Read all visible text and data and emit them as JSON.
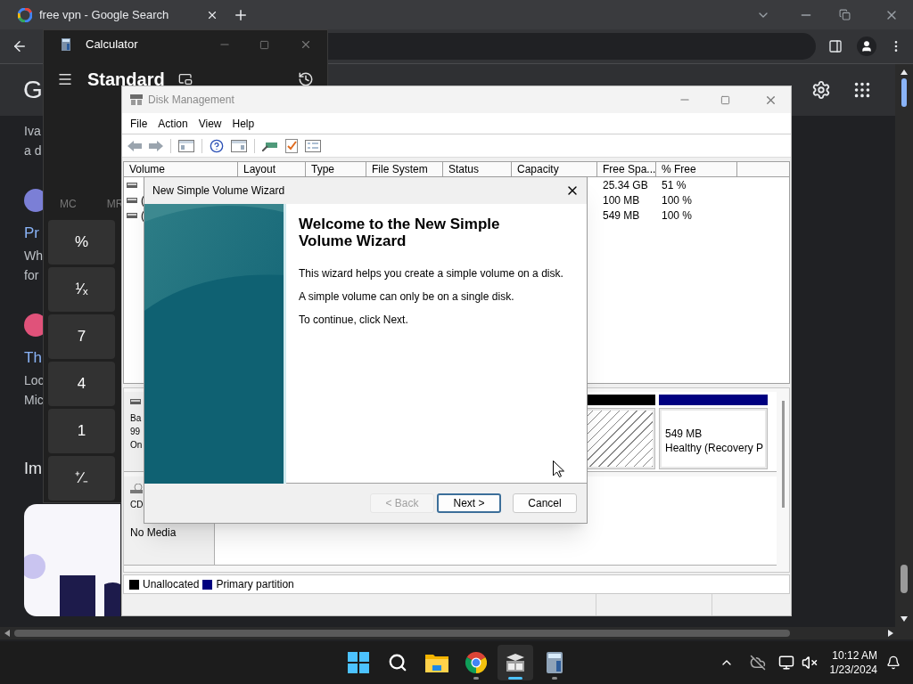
{
  "browser": {
    "tab": {
      "title": "free vpn - Google Search",
      "selected": true
    },
    "logo": "G",
    "results": [
      {
        "lines": [
          "Iva",
          "a d"
        ]
      },
      {
        "color": "#7b7fd6",
        "title": "Pr",
        "lines": [
          "Wh",
          "for"
        ]
      },
      {
        "color": "#e0527a",
        "title": "Th",
        "lines": [
          "Loc",
          "Mic"
        ]
      }
    ],
    "heading": "Im"
  },
  "calculator": {
    "title": "Calculator",
    "mode": "Standard",
    "memory": [
      "MC",
      "MR"
    ],
    "keys": [
      "%",
      "¹⁄ₓ",
      "7",
      "4",
      "1",
      "⁺∕₋"
    ]
  },
  "disk_management": {
    "title": "Disk Management",
    "menu": [
      "File",
      "Action",
      "View",
      "Help"
    ],
    "columns": [
      "Volume",
      "Layout",
      "Type",
      "File System",
      "Status",
      "Capacity",
      "Free Spa...",
      "% Free"
    ],
    "rows": [
      {
        "free_space": "25.34 GB",
        "percent_free": "51 %"
      },
      {
        "volume": "(",
        "free_space": "100 MB",
        "percent_free": "100 %"
      },
      {
        "volume": "(",
        "free_space": "549 MB",
        "percent_free": "100 %"
      }
    ],
    "disks": [
      {
        "kind": "basic",
        "lines": [
          "Ba",
          "99",
          "On"
        ],
        "partitions": [
          {
            "kind": "unallocated",
            "color": "#000000"
          },
          {
            "kind": "primary",
            "color": "#000080",
            "lines": [
              "549 MB",
              "Healthy (Recovery P"
            ]
          }
        ]
      },
      {
        "kind": "cdrom",
        "lines": [
          "CD"
        ],
        "status": "No Media"
      }
    ],
    "legend": [
      {
        "label": "Unallocated",
        "color": "#000000"
      },
      {
        "label": "Primary partition",
        "color": "#000080"
      }
    ]
  },
  "wizard": {
    "title": "New Simple Volume Wizard",
    "heading": "Welcome to the New Simple Volume Wizard",
    "paragraphs": [
      "This wizard helps you create a simple volume on a disk.",
      "A simple volume can only be on a single disk.",
      "To continue, click Next."
    ],
    "buttons": [
      {
        "label": "< Back",
        "disabled": true,
        "default": false
      },
      {
        "label": "Next >",
        "disabled": false,
        "default": true
      },
      {
        "label": "Cancel",
        "disabled": false,
        "default": false
      }
    ]
  },
  "taskbar": {
    "apps": [
      {
        "kind": "start",
        "running": false,
        "selected": false
      },
      {
        "kind": "search",
        "running": false,
        "selected": false
      },
      {
        "kind": "files",
        "running": false,
        "selected": false
      },
      {
        "kind": "chrome",
        "running": true,
        "selected": false
      },
      {
        "kind": "disk",
        "running": true,
        "selected": true
      },
      {
        "kind": "calculator",
        "running": true,
        "selected": false
      }
    ],
    "time": "10:12 AM",
    "date": "1/23/2024"
  }
}
